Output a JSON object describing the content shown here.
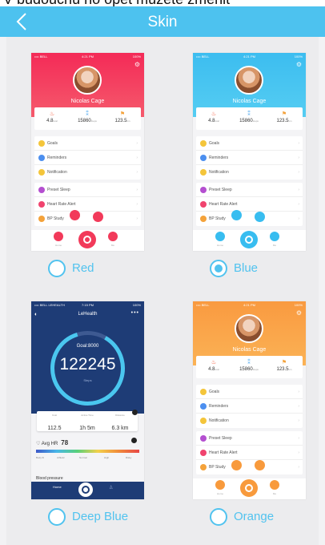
{
  "banner": {
    "text": "V budoucnu ho opět můžete změnit"
  },
  "navbar": {
    "title": "Skin"
  },
  "preview": {
    "status": {
      "carrier": "•••• BELL",
      "time": "4:21 PM",
      "battery": "100%"
    },
    "user_name": "Nicolas Cage",
    "stats": [
      {
        "icon": "flame-icon",
        "value": "4.8",
        "unit": "kcal"
      },
      {
        "icon": "footprints-icon",
        "value": "15860",
        "unit": "steps"
      },
      {
        "icon": "distance-icon",
        "value": "123.5",
        "unit": "km"
      }
    ],
    "menu1": [
      "Goals",
      "Reminders",
      "Notification"
    ],
    "menu2": [
      "Preset Sleep",
      "Heart Rate Alert",
      "BP Study"
    ],
    "tabs": {
      "home": "Home",
      "me": "Me"
    }
  },
  "skins": [
    {
      "label": "Red",
      "color": "#f43f5b",
      "selected": false
    },
    {
      "label": "Blue",
      "color": "#4cc6ef",
      "selected": true
    },
    {
      "label": "Deep Blue",
      "color": "#1e3c76",
      "selected": false
    },
    {
      "label": "Orange",
      "color": "#f7a24b",
      "selected": false
    }
  ],
  "deep_blue": {
    "status": {
      "carrier": "•••• BELL LEHEALTH",
      "time": "7:15 PM",
      "battery": "100%"
    },
    "app_title": "LeHealth",
    "goal": "Goal:8000",
    "steps": "122245",
    "sub": "Steps",
    "metrics": [
      {
        "label": "Kcal",
        "value": "112.5"
      },
      {
        "label": "Active Time",
        "value": "1h 5m"
      },
      {
        "label": "Distance",
        "value": "6.3 km"
      }
    ],
    "avg_hr_label": "Avg HR",
    "avg_hr_value": "78",
    "hr_scale": [
      "Body fit",
      "Athletic",
      "Normal",
      "High",
      "Risky"
    ],
    "bp_label": "Blood pressure",
    "home": "Home"
  }
}
